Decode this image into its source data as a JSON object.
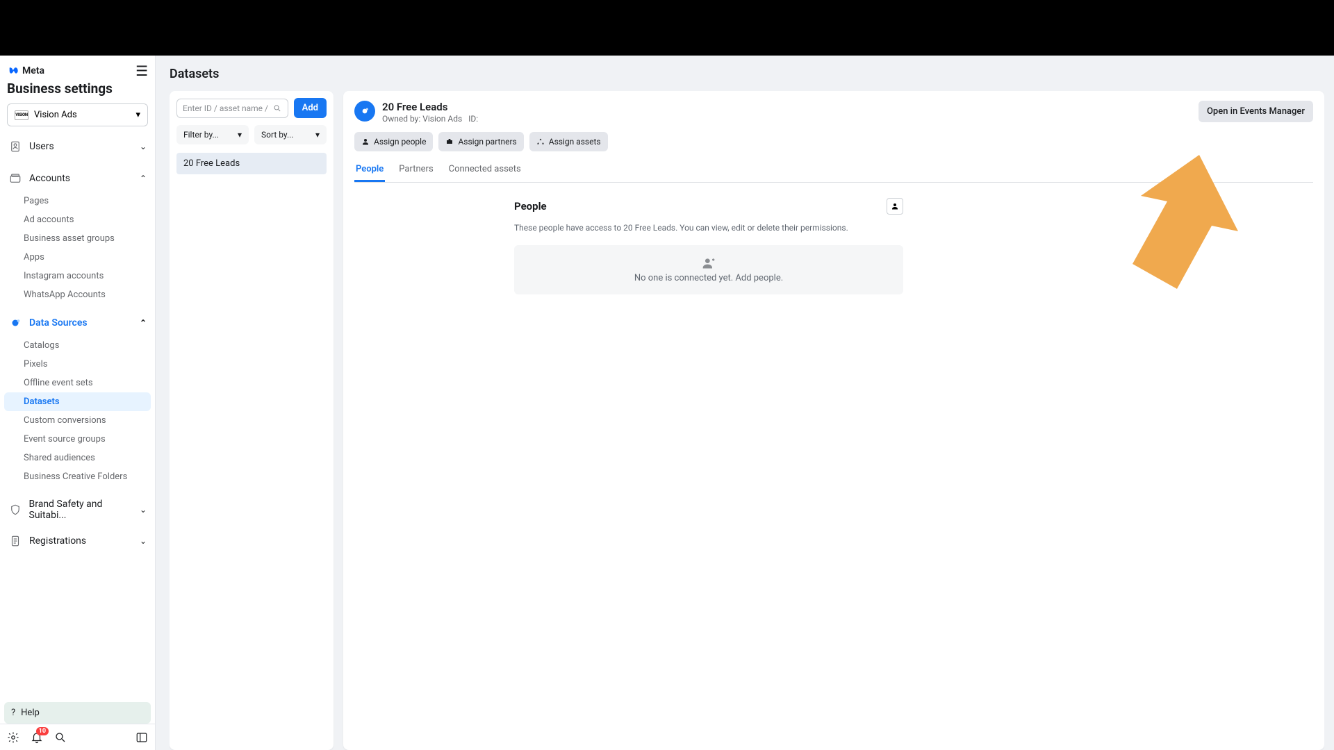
{
  "brand": "Meta",
  "pageTitle": "Business settings",
  "account": {
    "name": "Vision Ads",
    "logoText": "VISiON"
  },
  "notifications": {
    "count": 10
  },
  "nav": {
    "users": {
      "label": "Users"
    },
    "accounts": {
      "label": "Accounts",
      "items": [
        "Pages",
        "Ad accounts",
        "Business asset groups",
        "Apps",
        "Instagram accounts",
        "WhatsApp Accounts"
      ]
    },
    "dataSources": {
      "label": "Data Sources",
      "items": [
        "Catalogs",
        "Pixels",
        "Offline event sets",
        "Datasets",
        "Custom conversions",
        "Event source groups",
        "Shared audiences",
        "Business Creative Folders"
      ]
    },
    "brandSafety": {
      "label": "Brand Safety and Suitabi..."
    },
    "registrations": {
      "label": "Registrations"
    },
    "help": "Help"
  },
  "main": {
    "title": "Datasets",
    "search": {
      "placeholder": "Enter ID / asset name / busi..."
    },
    "addBtn": "Add",
    "filterBy": "Filter by...",
    "sortBy": "Sort by...",
    "datasets": [
      "20 Free Leads"
    ]
  },
  "detail": {
    "name": "20 Free Leads",
    "ownedBy": "Owned by: Vision Ads",
    "idLabel": "ID:",
    "openBtn": "Open in Events Manager",
    "actions": {
      "assignPeople": "Assign people",
      "assignPartners": "Assign partners",
      "assignAssets": "Assign assets"
    },
    "tabs": {
      "people": "People",
      "partners": "Partners",
      "connected": "Connected assets"
    },
    "people": {
      "title": "People",
      "desc": "These people have access to 20 Free Leads. You can view, edit or delete their permissions.",
      "empty": "No one is connected yet. Add people."
    }
  },
  "arrow": {
    "color": "#f0a94e"
  }
}
